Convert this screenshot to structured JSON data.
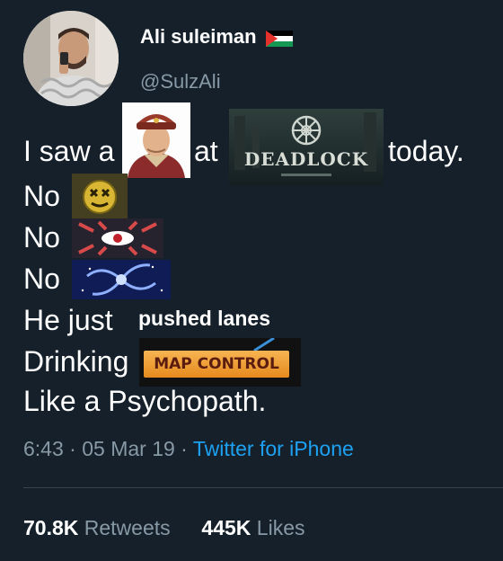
{
  "user": {
    "display_name": "Ali suleiman",
    "handle": "@SulzAli",
    "flag_icon": "palestine-flag-icon"
  },
  "tweet": {
    "line1_a": "I saw a",
    "line1_b": "at",
    "line1_c": "today.",
    "line2": "No",
    "line3": "No",
    "line4": "No",
    "line5_a": "He just",
    "line5_overlay": "pushed lanes",
    "line6_a": "Drinking",
    "line6_badge": "MAP CONTROL",
    "line7": "Like a Psychopath.",
    "logo_text": "DEADLOCK"
  },
  "meta": {
    "time": "6:43",
    "date": "05 Mar 19",
    "separator": "·",
    "source": "Twitter for iPhone"
  },
  "stats": {
    "retweets_count": "70.8K",
    "retweets_label": "Retweets",
    "likes_count": "445K",
    "likes_label": "Likes"
  },
  "colors": {
    "background": "#15202b",
    "secondary_text": "#8899a6",
    "link": "#1da1f2",
    "badge": "#f0a03c"
  }
}
